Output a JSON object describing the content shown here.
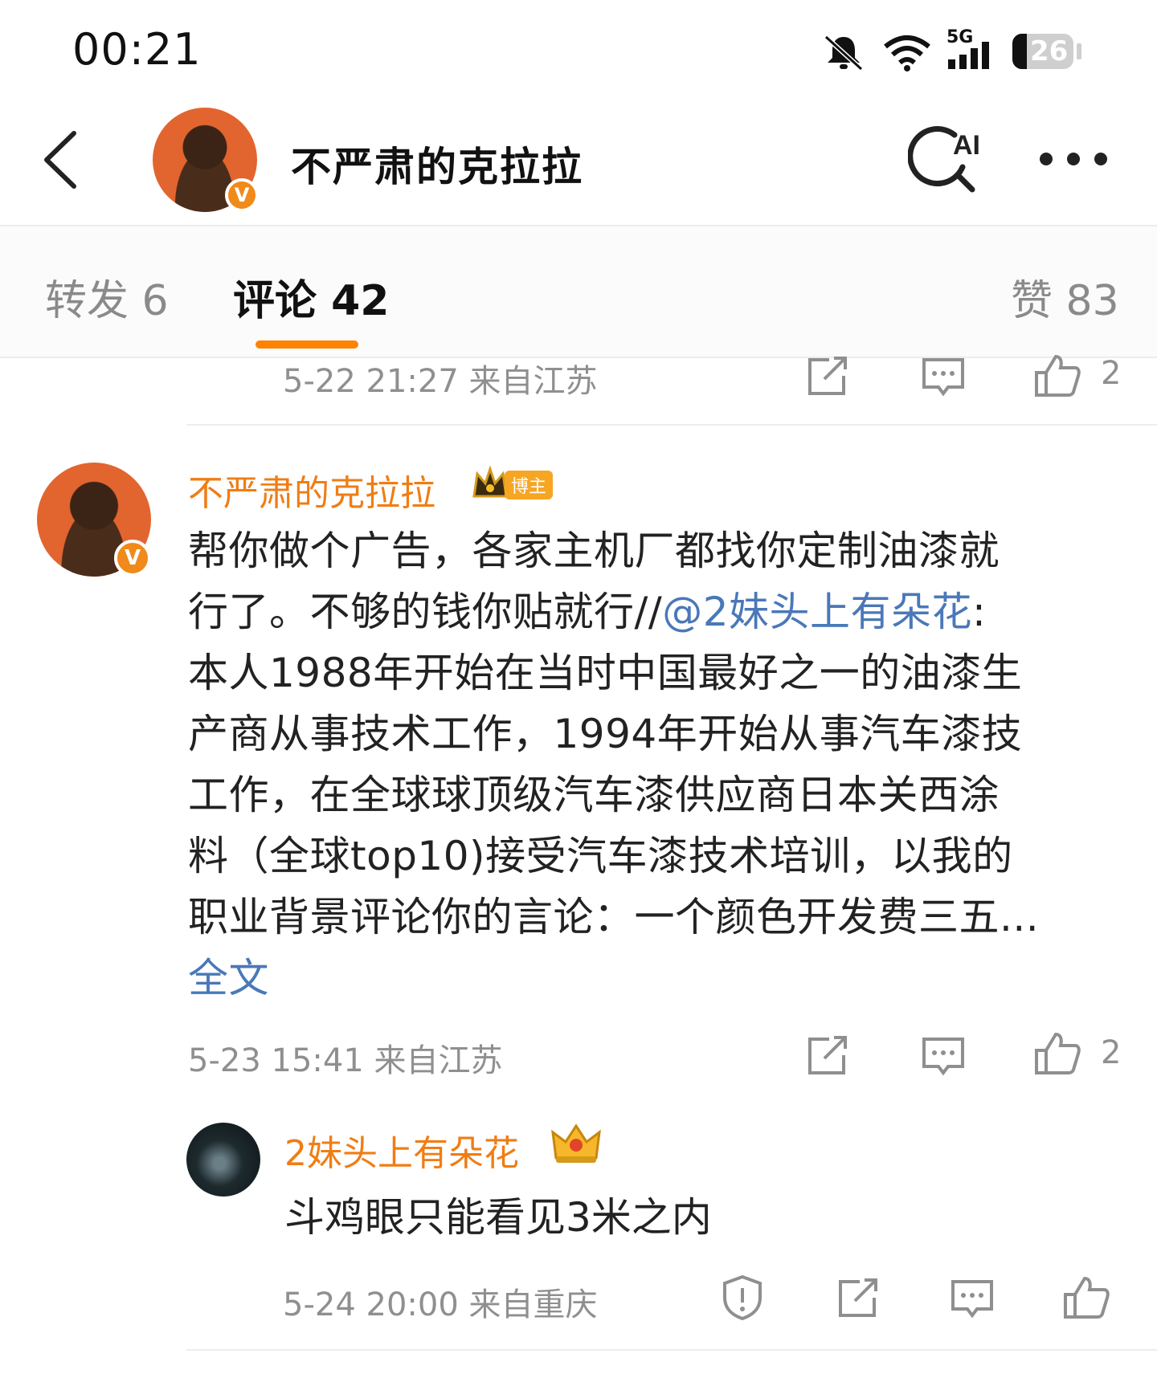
{
  "status_bar": {
    "time": "00:21",
    "network": "5G",
    "battery": "26"
  },
  "header": {
    "title": "不严肃的克拉拉",
    "ai_label": "AI"
  },
  "tabs": {
    "repost": "转发 6",
    "comments": "评论 42",
    "likes": "赞 83"
  },
  "prev_comment": {
    "meta": "5-22 21:27  来自江苏",
    "like_count": "2"
  },
  "comment": {
    "author": "不严肃的克拉拉",
    "role_badge": "博主",
    "lines": [
      "帮你做个广告，各家主机厂都找你定制油漆就",
      "本人1988年开始在当时中国最好之一的油漆生",
      "产商从事技术工作，1994年开始从事汽车漆技",
      "工作，在全球球顶级汽车漆供应商日本关西涂",
      "料（全球top10)接受汽车漆技术培训，以我的",
      "职业背景评论你的言论：一个颜色开发费三五..."
    ],
    "line2_prefix": "行了。不够的钱你贴就行//",
    "mention": "@2妹头上有朵花",
    "line2_suffix": ":",
    "full_text_link": "全文",
    "meta": "5-23 15:41  来自江苏",
    "like_count": "2"
  },
  "reply": {
    "author": "2妹头上有朵花",
    "text": "斗鸡眼只能看见3米之内",
    "meta": "5-24 20:00  来自重庆"
  },
  "colors": {
    "accent": "#ff8200",
    "name": "#f07d14",
    "link": "#4a78b8",
    "meta": "#8f8f8f"
  }
}
